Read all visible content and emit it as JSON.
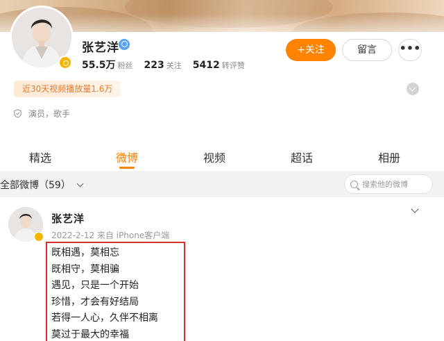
{
  "profile": {
    "name": "张艺洋",
    "stats": [
      {
        "value": "55.5万",
        "label": "粉丝"
      },
      {
        "value": "223",
        "label": "关注"
      },
      {
        "value": "5412",
        "label": "转评赞"
      }
    ],
    "follow_label": "+关注",
    "message_label": "留言",
    "more_label": "•••",
    "play_tag": "近30天视频播放量1.6万",
    "roles": "演员，歌手"
  },
  "tabs": [
    {
      "label": "精选",
      "active": false
    },
    {
      "label": "微博",
      "active": true
    },
    {
      "label": "视频",
      "active": false
    },
    {
      "label": "超话",
      "active": false
    },
    {
      "label": "相册",
      "active": false
    }
  ],
  "filter": {
    "all_label": "全部微博（59）",
    "search_placeholder": "搜索他的微博"
  },
  "post": {
    "author": "张艺洋",
    "meta": "2022-2-12  来自 iPhone客户端",
    "lines": [
      "既相遇，莫相忘",
      "既相守，莫相骗",
      "遇见，只是一个开始",
      "珍惜，才会有好结局",
      "若得一人心，久伴不相离",
      "莫过于最大的幸福"
    ]
  },
  "colors": {
    "accent": "#ff8200",
    "highlight_border": "#d9302c",
    "verified_blue": "#5aa3f1",
    "vip_gold": "#f7b500"
  },
  "icons": {
    "verified": "verified-icon",
    "vip": "vip-badge-icon",
    "more": "more-dots-icon",
    "expand": "chevron-down-icon",
    "roles": "shield-icon",
    "search": "search-icon"
  }
}
